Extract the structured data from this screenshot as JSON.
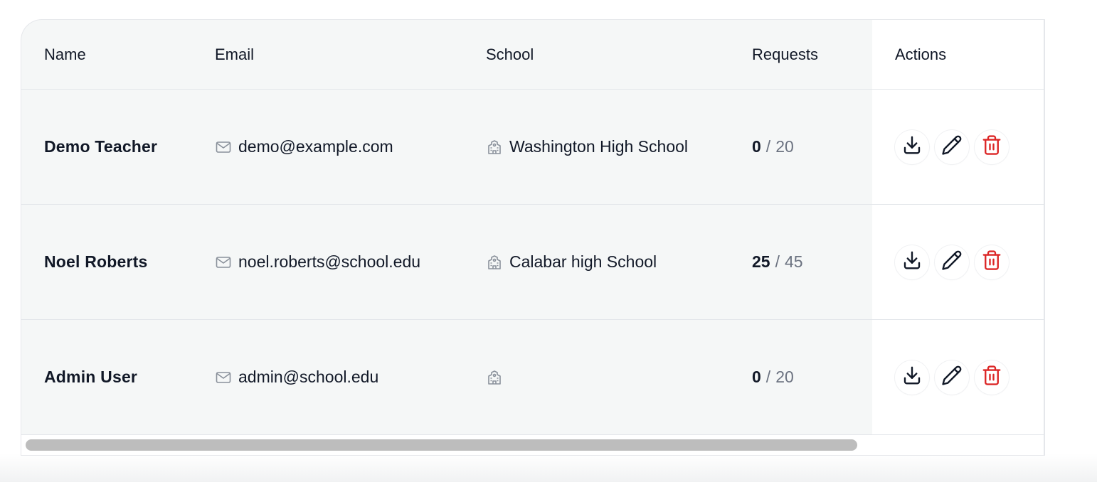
{
  "table": {
    "headers": {
      "name": "Name",
      "email": "Email",
      "school": "School",
      "requests": "Requests",
      "actions": "Actions"
    },
    "rows": [
      {
        "name": "Demo Teacher",
        "email": "demo@example.com",
        "school": "Washington High School",
        "requests_used": "0",
        "separator": "/",
        "requests_total": "20"
      },
      {
        "name": "Noel Roberts",
        "email": "noel.roberts@school.edu",
        "school": "Calabar high School",
        "requests_used": "25",
        "separator": "/",
        "requests_total": "45"
      },
      {
        "name": "Admin User",
        "email": "admin@school.edu",
        "school": "",
        "requests_used": "0",
        "separator": "/",
        "requests_total": "20"
      }
    ],
    "row_actions": [
      "download-icon",
      "edit-pencil-icon",
      "delete-trash-icon"
    ]
  },
  "colors": {
    "row_background": "#f5f7f7",
    "actions_background": "#ffffff",
    "muted_text": "#6b7280",
    "delete_accent": "#dc2626",
    "scrollbar_thumb": "#bdbdbd"
  }
}
